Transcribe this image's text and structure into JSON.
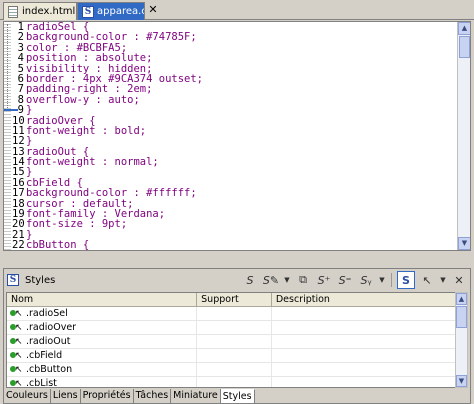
{
  "tabs": [
    {
      "label": "index.html",
      "icon": "html-file-icon"
    },
    {
      "label": "apparea.css",
      "icon": "stylesheet-icon"
    }
  ],
  "close_glyph": "✕",
  "editor": {
    "lines": [
      {
        "n": "1",
        "text": "radioSel {"
      },
      {
        "n": "2",
        "text": "background-color : #74785F;"
      },
      {
        "n": "3",
        "text": "color : #BCBFA5;"
      },
      {
        "n": "4",
        "text": "position : absolute;"
      },
      {
        "n": "5",
        "text": "visibility : hidden;"
      },
      {
        "n": "6",
        "text": "border : 4px #9CA374 outset;"
      },
      {
        "n": "7",
        "text": "padding-right : 2em;"
      },
      {
        "n": "8",
        "text": "overflow-y : auto;"
      },
      {
        "n": "9",
        "text": "}"
      },
      {
        "n": "10",
        "text": "radioOver {"
      },
      {
        "n": "11",
        "text": "font-weight : bold;"
      },
      {
        "n": "12",
        "text": "}"
      },
      {
        "n": "13",
        "text": "radioOut {"
      },
      {
        "n": "14",
        "text": "font-weight : normal;"
      },
      {
        "n": "15",
        "text": "}"
      },
      {
        "n": "16",
        "text": "cbField {"
      },
      {
        "n": "17",
        "text": "background-color : #ffffff;"
      },
      {
        "n": "18",
        "text": "cursor : default;"
      },
      {
        "n": "19",
        "text": "font-family : Verdana;"
      },
      {
        "n": "20",
        "text": "font-size : 9pt;"
      },
      {
        "n": "21",
        "text": "}"
      },
      {
        "n": "22",
        "text": "cbButton {"
      }
    ]
  },
  "panel": {
    "title": "Styles",
    "columns": [
      "Nom",
      "Support",
      "Description"
    ],
    "rows": [
      {
        "name": ".radioSel",
        "support": "",
        "description": ""
      },
      {
        "name": ".radioOver",
        "support": "",
        "description": ""
      },
      {
        "name": ".radioOut",
        "support": "",
        "description": ""
      },
      {
        "name": ".cbField",
        "support": "",
        "description": ""
      },
      {
        "name": ".cbButton",
        "support": "",
        "description": ""
      },
      {
        "name": ".cbList",
        "support": "",
        "description": ""
      }
    ],
    "bottom_tabs": [
      "Couleurs",
      "Liens",
      "Propriétés",
      "Tâches",
      "Miniature",
      "Styles"
    ],
    "active_tab": "Styles"
  },
  "colors": {
    "code_text": "#7f007f",
    "selection_blue": "#316ac5",
    "style_dot": "#2a9d2a"
  }
}
